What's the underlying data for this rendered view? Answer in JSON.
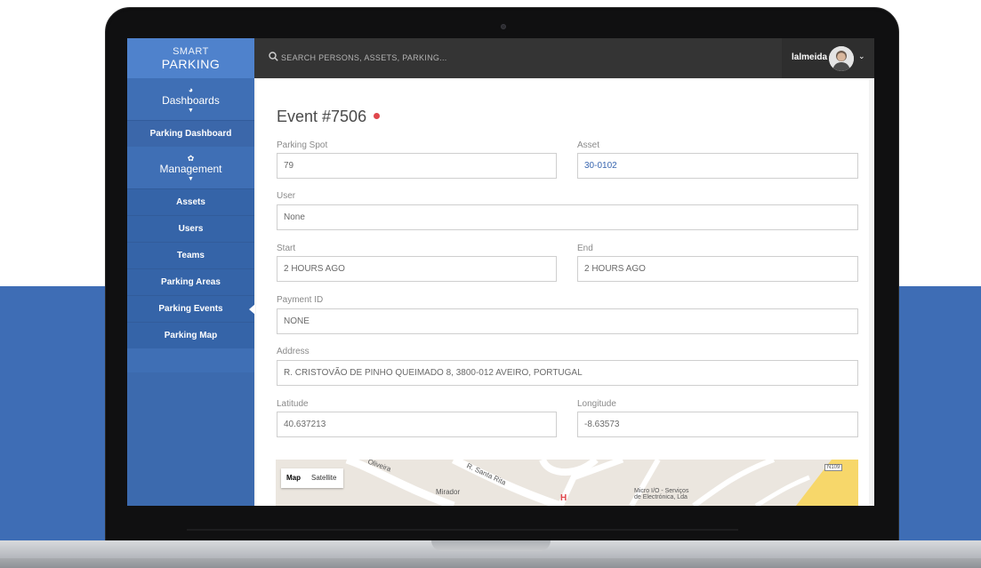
{
  "brand": {
    "line1": "SMART",
    "line2": "PARKING"
  },
  "search": {
    "placeholder": "SEARCH PERSONS, ASSETS, PARKING..."
  },
  "user": {
    "name": "lalmeida"
  },
  "sidebar": {
    "dashboards": {
      "label": "Dashboards",
      "icon": "dashboard-icon"
    },
    "dashboard_items": [
      {
        "label": "Parking Dashboard"
      }
    ],
    "management": {
      "label": "Management",
      "icon": "gear-icon"
    },
    "management_items": [
      {
        "label": "Assets"
      },
      {
        "label": "Users"
      },
      {
        "label": "Teams"
      },
      {
        "label": "Parking Areas"
      },
      {
        "label": "Parking Events",
        "active": true
      },
      {
        "label": "Parking Map"
      }
    ]
  },
  "event": {
    "title": "Event #7506",
    "status_color": "#e0474c",
    "fields": {
      "parking_spot": {
        "label": "Parking Spot",
        "value": "79"
      },
      "asset": {
        "label": "Asset",
        "value": "30-0102"
      },
      "user": {
        "label": "User",
        "value": "None"
      },
      "start": {
        "label": "Start",
        "value": "2 HOURS AGO"
      },
      "end": {
        "label": "End",
        "value": "2 HOURS AGO"
      },
      "payment_id": {
        "label": "Payment ID",
        "value": "NONE"
      },
      "address": {
        "label": "Address",
        "value": "R. CRISTOVÃO DE PINHO QUEIMADO 8, 3800-012 AVEIRO, PORTUGAL"
      },
      "latitude": {
        "label": "Latitude",
        "value": "40.637213"
      },
      "longitude": {
        "label": "Longitude",
        "value": "-8.63573"
      }
    }
  },
  "map": {
    "tabs": {
      "map": "Map",
      "satellite": "Satellite"
    },
    "labels": {
      "oliveira": "Oliveira",
      "santa_rita": "R. Santa Rita",
      "mirador": "Mirador",
      "hospital": "H",
      "micro_line1": "Micro I/O - Serviços",
      "micro_line2": "de Electrónica, Lda",
      "road": "N109"
    }
  },
  "colors": {
    "sidebar": "#3f6fb5",
    "brand": "#4f82cc",
    "topbar": "#343434",
    "link": "#3a67b0",
    "background_band": "#3e6db5"
  }
}
